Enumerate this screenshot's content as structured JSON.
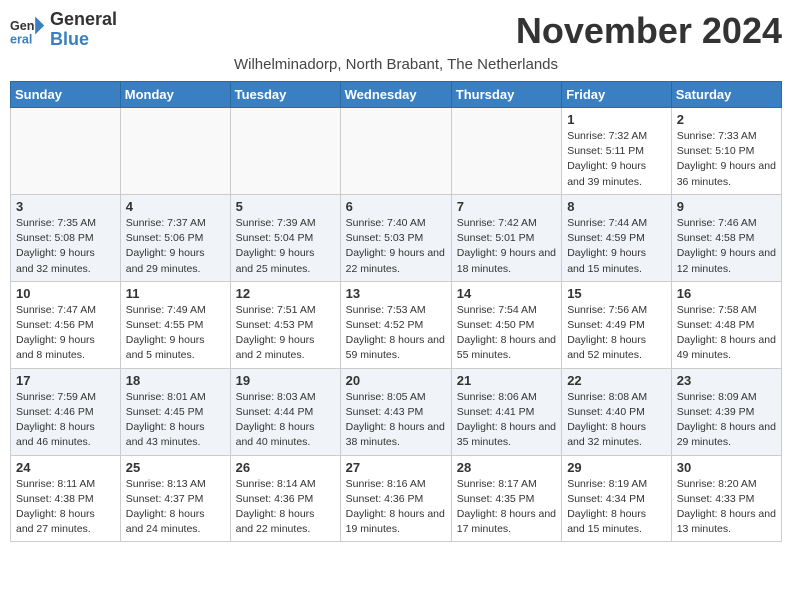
{
  "app": {
    "logo_line1": "General",
    "logo_line2": "Blue"
  },
  "header": {
    "month_title": "November 2024",
    "subtitle": "Wilhelminadorp, North Brabant, The Netherlands"
  },
  "days_of_week": [
    "Sunday",
    "Monday",
    "Tuesday",
    "Wednesday",
    "Thursday",
    "Friday",
    "Saturday"
  ],
  "weeks": [
    [
      {
        "day": "",
        "info": ""
      },
      {
        "day": "",
        "info": ""
      },
      {
        "day": "",
        "info": ""
      },
      {
        "day": "",
        "info": ""
      },
      {
        "day": "",
        "info": ""
      },
      {
        "day": "1",
        "info": "Sunrise: 7:32 AM\nSunset: 5:11 PM\nDaylight: 9 hours and 39 minutes."
      },
      {
        "day": "2",
        "info": "Sunrise: 7:33 AM\nSunset: 5:10 PM\nDaylight: 9 hours and 36 minutes."
      }
    ],
    [
      {
        "day": "3",
        "info": "Sunrise: 7:35 AM\nSunset: 5:08 PM\nDaylight: 9 hours and 32 minutes."
      },
      {
        "day": "4",
        "info": "Sunrise: 7:37 AM\nSunset: 5:06 PM\nDaylight: 9 hours and 29 minutes."
      },
      {
        "day": "5",
        "info": "Sunrise: 7:39 AM\nSunset: 5:04 PM\nDaylight: 9 hours and 25 minutes."
      },
      {
        "day": "6",
        "info": "Sunrise: 7:40 AM\nSunset: 5:03 PM\nDaylight: 9 hours and 22 minutes."
      },
      {
        "day": "7",
        "info": "Sunrise: 7:42 AM\nSunset: 5:01 PM\nDaylight: 9 hours and 18 minutes."
      },
      {
        "day": "8",
        "info": "Sunrise: 7:44 AM\nSunset: 4:59 PM\nDaylight: 9 hours and 15 minutes."
      },
      {
        "day": "9",
        "info": "Sunrise: 7:46 AM\nSunset: 4:58 PM\nDaylight: 9 hours and 12 minutes."
      }
    ],
    [
      {
        "day": "10",
        "info": "Sunrise: 7:47 AM\nSunset: 4:56 PM\nDaylight: 9 hours and 8 minutes."
      },
      {
        "day": "11",
        "info": "Sunrise: 7:49 AM\nSunset: 4:55 PM\nDaylight: 9 hours and 5 minutes."
      },
      {
        "day": "12",
        "info": "Sunrise: 7:51 AM\nSunset: 4:53 PM\nDaylight: 9 hours and 2 minutes."
      },
      {
        "day": "13",
        "info": "Sunrise: 7:53 AM\nSunset: 4:52 PM\nDaylight: 8 hours and 59 minutes."
      },
      {
        "day": "14",
        "info": "Sunrise: 7:54 AM\nSunset: 4:50 PM\nDaylight: 8 hours and 55 minutes."
      },
      {
        "day": "15",
        "info": "Sunrise: 7:56 AM\nSunset: 4:49 PM\nDaylight: 8 hours and 52 minutes."
      },
      {
        "day": "16",
        "info": "Sunrise: 7:58 AM\nSunset: 4:48 PM\nDaylight: 8 hours and 49 minutes."
      }
    ],
    [
      {
        "day": "17",
        "info": "Sunrise: 7:59 AM\nSunset: 4:46 PM\nDaylight: 8 hours and 46 minutes."
      },
      {
        "day": "18",
        "info": "Sunrise: 8:01 AM\nSunset: 4:45 PM\nDaylight: 8 hours and 43 minutes."
      },
      {
        "day": "19",
        "info": "Sunrise: 8:03 AM\nSunset: 4:44 PM\nDaylight: 8 hours and 40 minutes."
      },
      {
        "day": "20",
        "info": "Sunrise: 8:05 AM\nSunset: 4:43 PM\nDaylight: 8 hours and 38 minutes."
      },
      {
        "day": "21",
        "info": "Sunrise: 8:06 AM\nSunset: 4:41 PM\nDaylight: 8 hours and 35 minutes."
      },
      {
        "day": "22",
        "info": "Sunrise: 8:08 AM\nSunset: 4:40 PM\nDaylight: 8 hours and 32 minutes."
      },
      {
        "day": "23",
        "info": "Sunrise: 8:09 AM\nSunset: 4:39 PM\nDaylight: 8 hours and 29 minutes."
      }
    ],
    [
      {
        "day": "24",
        "info": "Sunrise: 8:11 AM\nSunset: 4:38 PM\nDaylight: 8 hours and 27 minutes."
      },
      {
        "day": "25",
        "info": "Sunrise: 8:13 AM\nSunset: 4:37 PM\nDaylight: 8 hours and 24 minutes."
      },
      {
        "day": "26",
        "info": "Sunrise: 8:14 AM\nSunset: 4:36 PM\nDaylight: 8 hours and 22 minutes."
      },
      {
        "day": "27",
        "info": "Sunrise: 8:16 AM\nSunset: 4:36 PM\nDaylight: 8 hours and 19 minutes."
      },
      {
        "day": "28",
        "info": "Sunrise: 8:17 AM\nSunset: 4:35 PM\nDaylight: 8 hours and 17 minutes."
      },
      {
        "day": "29",
        "info": "Sunrise: 8:19 AM\nSunset: 4:34 PM\nDaylight: 8 hours and 15 minutes."
      },
      {
        "day": "30",
        "info": "Sunrise: 8:20 AM\nSunset: 4:33 PM\nDaylight: 8 hours and 13 minutes."
      }
    ]
  ]
}
